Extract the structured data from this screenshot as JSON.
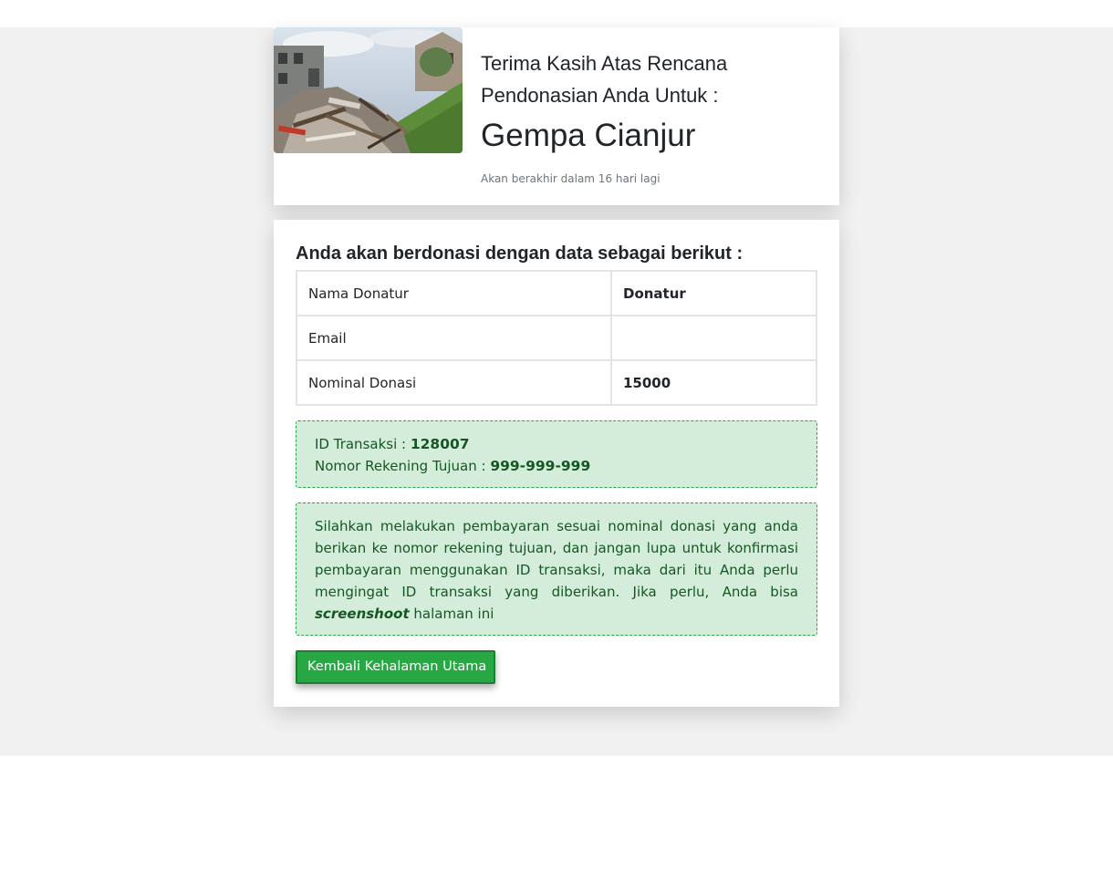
{
  "campaign": {
    "thanks_text": "Terima Kasih Atas Rencana Pendonasian Anda Untuk :",
    "title": "Gempa Cianjur",
    "countdown": "Akan berakhir dalam 16 hari lagi",
    "photo_subject": "earthquake-rubble"
  },
  "summary": {
    "heading": "Anda akan berdonasi dengan data sebagai berikut :",
    "rows": [
      {
        "label": "Nama Donatur",
        "value": "Donatur"
      },
      {
        "label": "Email",
        "value": ""
      },
      {
        "label": "Nominal Donasi",
        "value": "15000"
      }
    ]
  },
  "transaction": {
    "id_label": "ID Transaksi : ",
    "id_value": "128007",
    "account_label": "Nomor Rekening Tujuan : ",
    "account_value": "999-999-999"
  },
  "instructions": {
    "text_before": "Silahkan melakukan pembayaran sesuai nominal donasi yang anda berikan ke nomor rekening tujuan, dan jangan lupa untuk konfirmasi pembayaran menggunakan ID transaksi, maka dari itu Anda perlu mengingat ID transaksi yang diberikan. Jika perlu, Anda bisa ",
    "emphasis": "screenshoot",
    "text_after": " halaman ini"
  },
  "actions": {
    "back_label": "Kembali Kehalaman Utama"
  },
  "colors": {
    "accent": "#28a745",
    "alert_bg": "#d4edda",
    "alert_text": "#155724",
    "page_band": "#f1f1f1"
  }
}
